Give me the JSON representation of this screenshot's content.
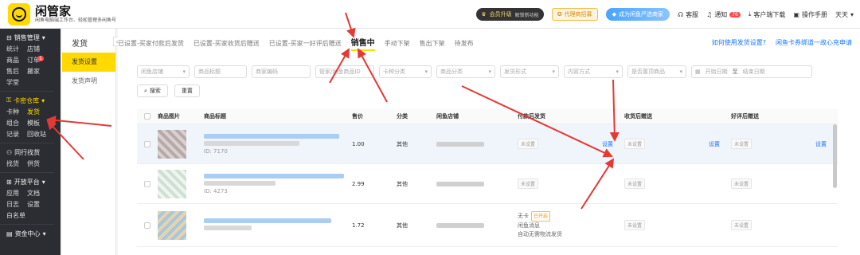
{
  "header": {
    "brand_name": "闲管家",
    "brand_sub": "闲鱼电脑端工作台、轻松管理多闲鱼号",
    "vip_label": "会员升级",
    "vip_sub": "解锁新功能",
    "agent_label": "代理商招募",
    "merchant_label": "成为闲鱼严选商家",
    "service_label": "客服",
    "notice_label": "通知",
    "notice_count": "76",
    "download_label": "客户端下载",
    "manual_label": "操作手册",
    "user_name": "天天"
  },
  "sidebar": {
    "sales_title": "销售管理",
    "sales_rows": [
      [
        "统计",
        "店铺"
      ],
      [
        "商品",
        "订单"
      ],
      [
        "售后",
        "搬家"
      ],
      [
        "学堂",
        ""
      ]
    ],
    "order_badge": "1",
    "card_title": "卡密仓库",
    "card_rows": [
      [
        "卡种",
        "发货"
      ],
      [
        "组合",
        "模板"
      ],
      [
        "记录",
        "回收站"
      ]
    ],
    "peer_title": "同行找货",
    "peer_rows": [
      [
        "找货",
        "供货"
      ]
    ],
    "open_title": "开放平台",
    "open_rows": [
      [
        "应用",
        "文档"
      ],
      [
        "日志",
        "设置"
      ],
      [
        "白名单",
        ""
      ]
    ],
    "fund_title": "资金中心"
  },
  "subnav": {
    "title": "发货",
    "items": [
      "发货设置",
      "发货声明"
    ]
  },
  "tabs": {
    "items": [
      "已设置-买家付款后发货",
      "已设置-买家收货后赠送",
      "已设置-买家一好评后赠送",
      "销售中",
      "手动下架",
      "售出下架",
      "待发布"
    ],
    "help_link": "如何使用发货设置?",
    "notice_link": "闲鱼卡券绑道一故心充申请"
  },
  "filters": {
    "items": [
      "闲鱼店铺",
      "商品标题",
      "商家编码",
      "管家/闲鱼商品ID",
      "卡种分类",
      "商品分类",
      "发货形式",
      "内容方式",
      "是否置顶商品"
    ],
    "start_date": "开始日期",
    "date_sep": "至",
    "end_date": "结束日期",
    "search_btn": "搜索",
    "reset_btn": "重置"
  },
  "table": {
    "headers": [
      "商品图片",
      "商品标题",
      "售价",
      "分类",
      "闲鱼店铺",
      "付款后发货",
      "收货后赠送",
      "好评后赠送"
    ],
    "unset_label": "未设置",
    "set_link": "设置",
    "rows": [
      {
        "id": "ID: 7170",
        "price": "1.00",
        "category": "其他"
      },
      {
        "id": "ID: 4273",
        "price": "2.99",
        "category": "其他"
      },
      {
        "id": "",
        "price": "1.72",
        "category": "其他",
        "pay_lines": [
          "无卡",
          "闲鱼消息",
          "自动无需物流发货"
        ],
        "pay_tag": "已开启"
      }
    ]
  }
}
